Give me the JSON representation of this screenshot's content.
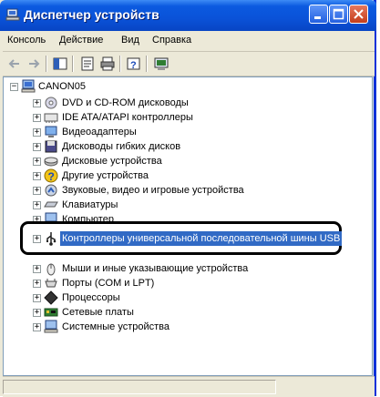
{
  "window": {
    "title": "Диспетчер устройств"
  },
  "menu": {
    "items": [
      "Консоль",
      "Действие",
      "Вид",
      "Справка"
    ]
  },
  "toolbar": {
    "buttons": [
      "back-arrow",
      "forward-arrow",
      "console-tree-icon",
      "properties-icon",
      "print-icon",
      "help-icon",
      "scan-hardware-icon"
    ]
  },
  "tree": {
    "root": "CANON05",
    "items": [
      "DVD и CD-ROM дисководы",
      "IDE ATA/ATAPI контроллеры",
      "Видеоадаптеры",
      "Дисководы гибких дисков",
      "Дисковые устройства",
      "Другие устройства",
      "Звуковые, видео и игровые устройства",
      "Клавиатуры",
      "Компьютер"
    ],
    "highlighted": "Контроллеры универсальной последовательной шины USB",
    "items_after": [
      "Мыши и иные указывающие устройства",
      "Порты (COM и LPT)",
      "Процессоры",
      "Сетевые платы",
      "Системные устройства"
    ]
  },
  "colors": {
    "titlebar": "#0a52d8",
    "selection": "#316ac5",
    "window_bg": "#ece9d8"
  }
}
